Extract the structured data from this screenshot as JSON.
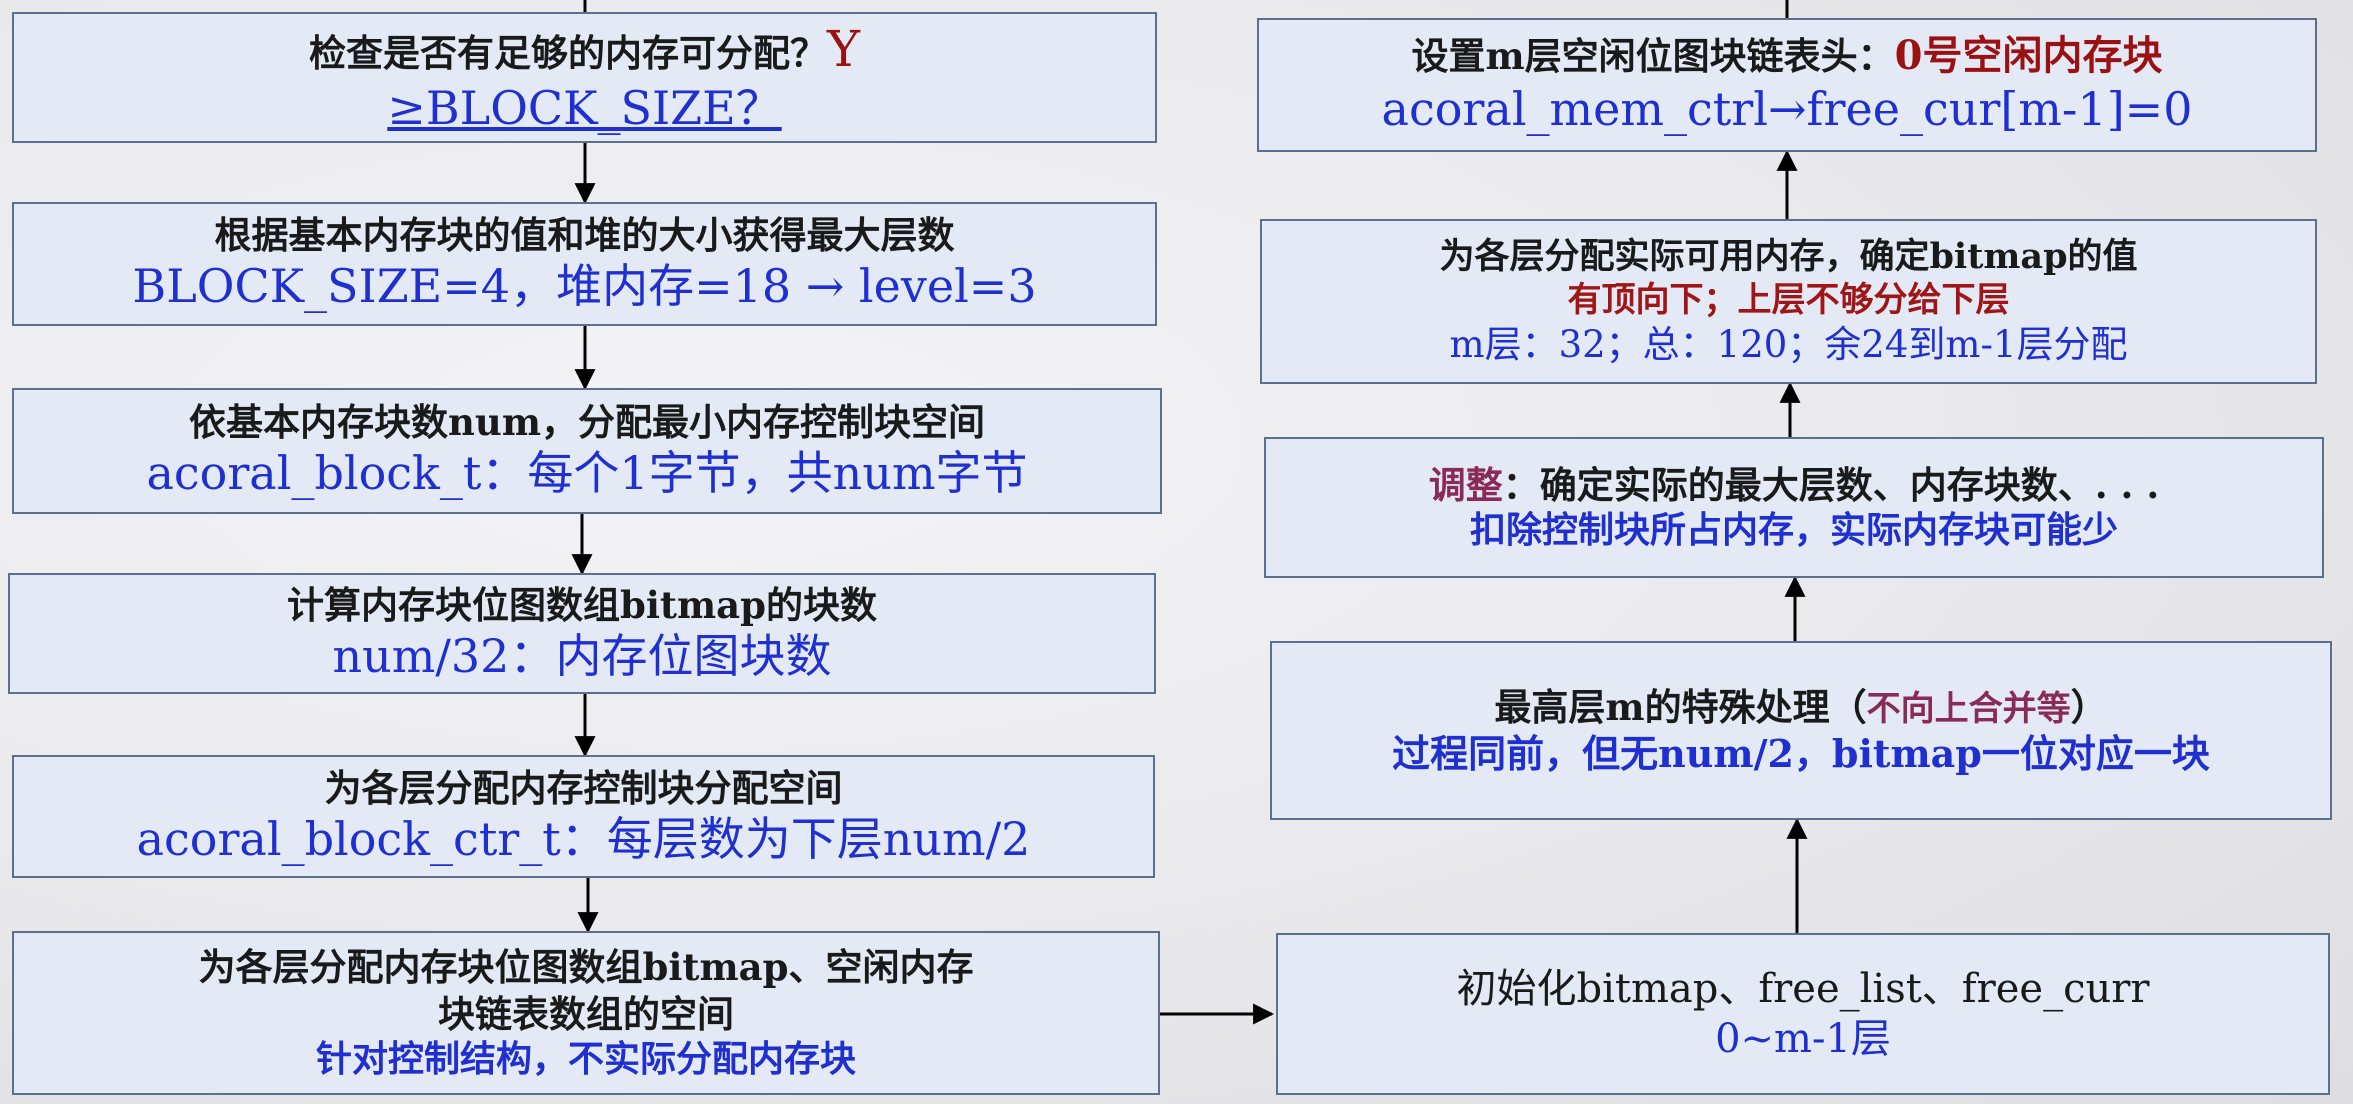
{
  "left": [
    {
      "id": "check",
      "line1": "检查是否有足够的内存可分配？",
      "line1_mark": "Y",
      "line2": "≥BLOCK_SIZE？"
    },
    {
      "id": "level",
      "line1": "根据基本内存块的值和堆的大小获得最大层数",
      "line2": "BLOCK_SIZE=4，堆内存=18 → level=3"
    },
    {
      "id": "num",
      "line1": "依基本内存块数num，分配最小内存控制块空间",
      "line2": "acoral_block_t：每个1字节，共num字节"
    },
    {
      "id": "bitmap",
      "line1": "计算内存块位图数组bitmap的块数",
      "line2": "num/32：内存位图块数"
    },
    {
      "id": "ctr",
      "line1": "为各层分配内存控制块分配空间",
      "line2": "acoral_block_ctr_t：每层数为下层num/2"
    },
    {
      "id": "arrays",
      "line1": "为各层分配内存块位图数组bitmap、空闲内存",
      "line2": "块链表数组的空间",
      "line3": "针对控制结构，不实际分配内存块"
    }
  ],
  "right": [
    {
      "id": "head",
      "line1": "设置m层空闲位图块链表头：",
      "line1_mark": "0号空闲内存块",
      "line2": "acoral_mem_ctrl→free_cur[m-1]=0"
    },
    {
      "id": "assign",
      "line1": "为各层分配实际可用内存，确定bitmap的值",
      "line2": "有顶向下；上层不够分给下层",
      "line3": "m层：32；总：120；余24到m-1层分配"
    },
    {
      "id": "adjust",
      "line1_mark": "调整",
      "line1": "：确定实际的最大层数、内存块数、. . .",
      "line2": "扣除控制块所占内存，实际内存块可能少"
    },
    {
      "id": "top",
      "line1": "最高层m的特殊处理（",
      "line1_mark": "不向上合并等",
      "line1_end": "）",
      "line2": "过程同前，但无num/2，bitmap一位对应一块"
    },
    {
      "id": "init",
      "line1": "初始化bitmap、free_list、free_curr",
      "line2": "0~m-1层"
    }
  ],
  "colors": {
    "box_fill": "#e3eaf6",
    "box_border": "#5b6f8e",
    "blue_text": "#1f2fd0",
    "red_text": "#9a1111",
    "arrow": "#000000"
  }
}
